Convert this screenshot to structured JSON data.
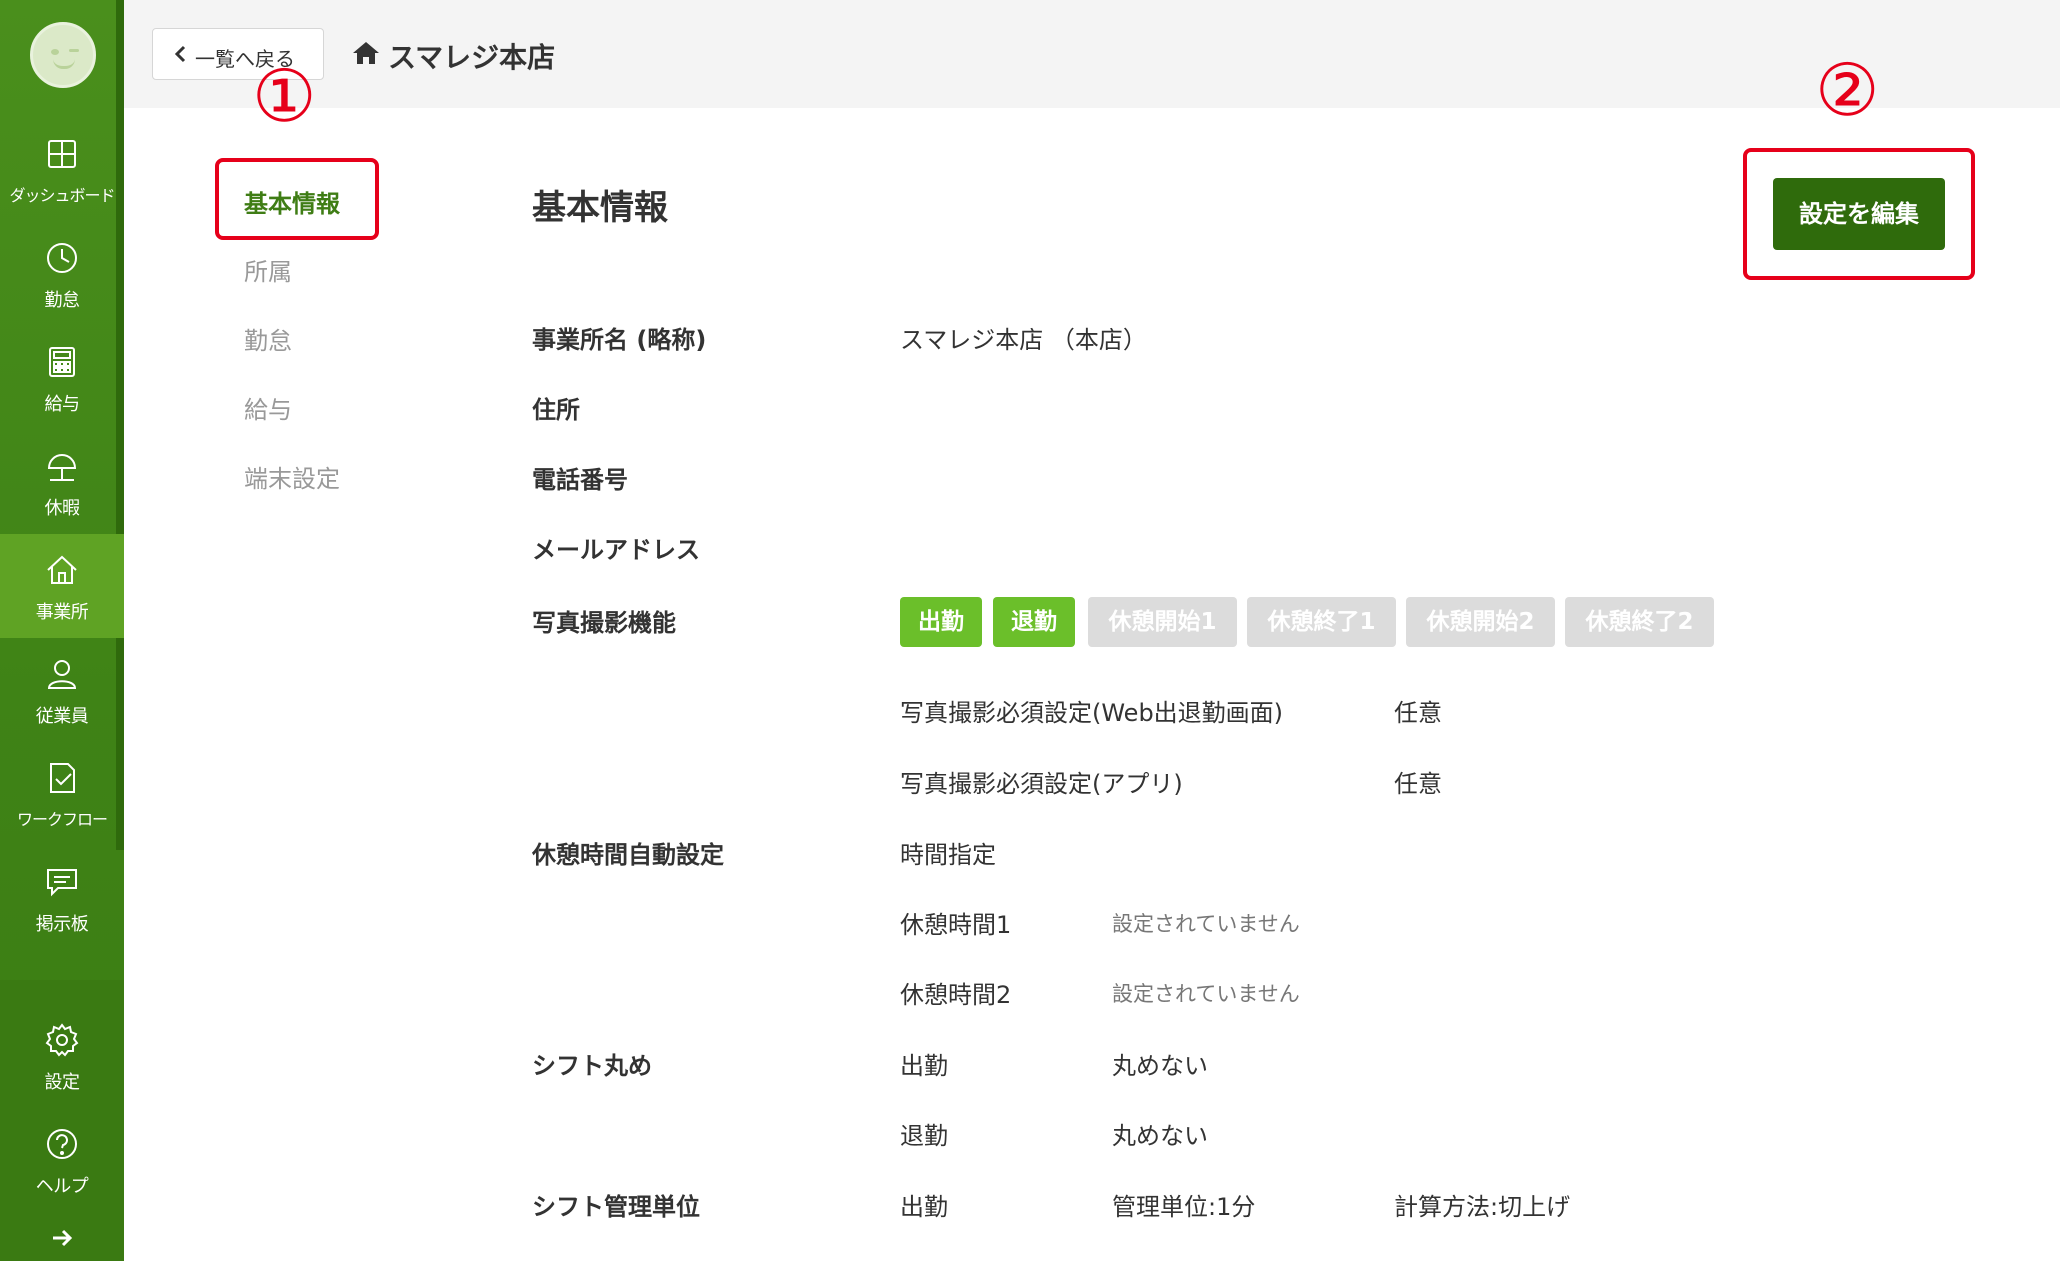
{
  "sidebar": {
    "items": [
      {
        "label": "ダッシュボード",
        "icon": "dashboard-icon"
      },
      {
        "label": "勤怠",
        "icon": "clock-icon"
      },
      {
        "label": "給与",
        "icon": "calculator-icon"
      },
      {
        "label": "休暇",
        "icon": "umbrella-icon"
      },
      {
        "label": "事業所",
        "icon": "home-icon"
      },
      {
        "label": "従業員",
        "icon": "person-icon"
      },
      {
        "label": "ワークフロー",
        "icon": "checklist-icon"
      },
      {
        "label": "掲示板",
        "icon": "message-icon"
      },
      {
        "label": "設定",
        "icon": "gear-icon"
      },
      {
        "label": "ヘルプ",
        "icon": "help-icon"
      }
    ],
    "active": "事業所"
  },
  "header": {
    "back_label": "一覧へ戻る",
    "store_name": "スマレジ本店"
  },
  "subnav": {
    "items": [
      "基本情報",
      "所属",
      "勤怠",
      "給与",
      "端末設定"
    ],
    "active": "基本情報"
  },
  "annotations": {
    "one": "①",
    "two": "②"
  },
  "main": {
    "title": "基本情報",
    "edit_button": "設定を編集",
    "fields": {
      "office_name_label": "事業所名 (略称)",
      "office_name_value": "スマレジ本店 （本店）",
      "address_label": "住所",
      "phone_label": "電話番号",
      "email_label": "メールアドレス",
      "photo_label": "写真撮影機能",
      "photo_badges": [
        {
          "label": "出勤",
          "enabled": true
        },
        {
          "label": "退勤",
          "enabled": true
        },
        {
          "label": "休憩開始1",
          "enabled": false
        },
        {
          "label": "休憩終了1",
          "enabled": false
        },
        {
          "label": "休憩開始2",
          "enabled": false
        },
        {
          "label": "休憩終了2",
          "enabled": false
        }
      ],
      "photo_web_label": "写真撮影必須設定(Web出退勤画面)",
      "photo_web_value": "任意",
      "photo_app_label": "写真撮影必須設定(アプリ)",
      "photo_app_value": "任意",
      "break_label": "休憩時間自動設定",
      "break_mode": "時間指定",
      "break1_label": "休憩時間1",
      "break1_value": "設定されていません",
      "break2_label": "休憩時間2",
      "break2_value": "設定されていません",
      "shift_round_label": "シフト丸め",
      "shift_round_in_label": "出勤",
      "shift_round_in_value": "丸めない",
      "shift_round_out_label": "退勤",
      "shift_round_out_value": "丸めない",
      "shift_unit_label": "シフト管理単位",
      "shift_unit_in_label": "出勤",
      "shift_unit_value": "管理単位:1分",
      "shift_unit_calc": "計算方法:切上げ"
    }
  },
  "colors": {
    "sidebar": "#4a8f1c",
    "accent": "#2f6b0c",
    "badge_on": "#6bbf2a",
    "badge_off": "#dcdcdc",
    "annotation": "#e6001a"
  }
}
